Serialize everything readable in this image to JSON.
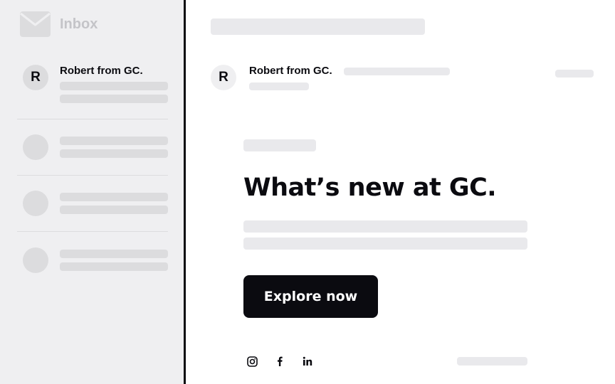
{
  "sidebar": {
    "title": "Inbox",
    "icon": "envelope-icon",
    "items": [
      {
        "avatar_initial": "R",
        "sender": "Robert from GC."
      }
    ]
  },
  "email": {
    "sender": "Robert from GC.",
    "avatar_initial": "R",
    "headline": "What’s new at GC.",
    "cta_label": "Explore now",
    "social_icons": [
      "instagram-icon",
      "facebook-icon",
      "linkedin-icon"
    ]
  },
  "colors": {
    "sidebar_bg": "#efeff1",
    "skeleton": "#dcdcde",
    "skeleton_light": "#e9e9ec",
    "primary": "#0b0b10",
    "muted_text": "#c4c4c8"
  }
}
